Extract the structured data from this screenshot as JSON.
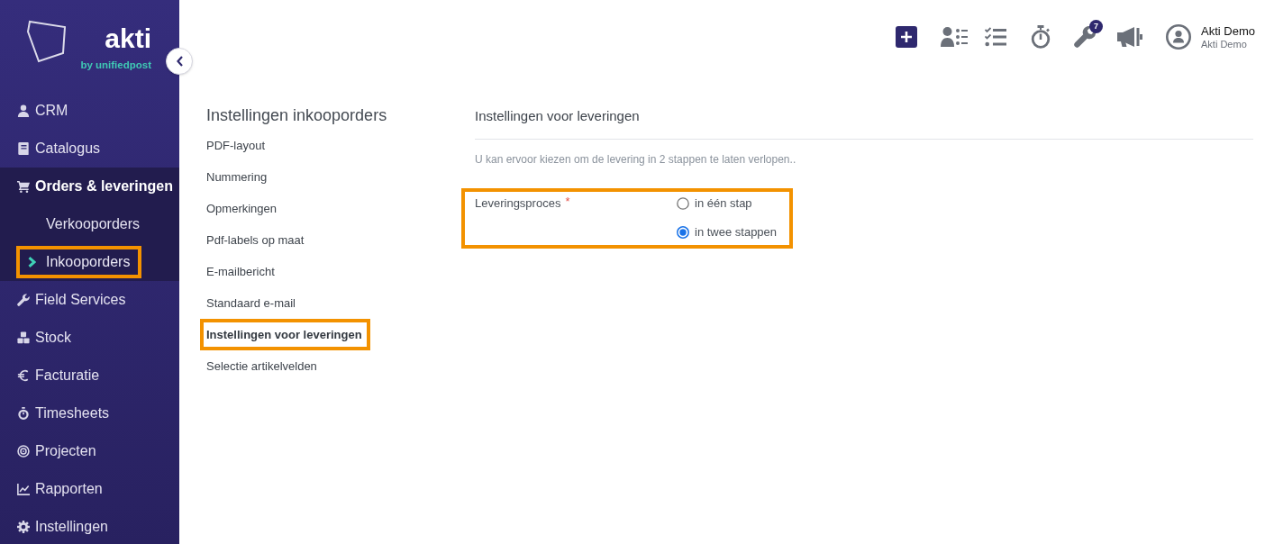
{
  "logo": {
    "wordmark": "akti",
    "tagline": "by unifiedpost"
  },
  "sidebar": {
    "items": [
      {
        "label": "CRM",
        "expanded": false
      },
      {
        "label": "Catalogus",
        "expanded": false
      },
      {
        "label": "Orders & leveringen",
        "expanded": true,
        "children": [
          {
            "label": "Verkooporders",
            "selected": false,
            "highlighted": false
          },
          {
            "label": "Inkooporders",
            "selected": true,
            "highlighted": true
          }
        ]
      },
      {
        "label": "Field Services",
        "expanded": false
      },
      {
        "label": "Stock",
        "expanded": false
      },
      {
        "label": "Facturatie",
        "expanded": false
      },
      {
        "label": "Timesheets",
        "expanded": false
      },
      {
        "label": "Projecten",
        "expanded": false
      },
      {
        "label": "Rapporten",
        "expanded": false
      },
      {
        "label": "Instellingen",
        "expanded": false
      }
    ]
  },
  "header": {
    "notification_count": "7",
    "user": {
      "name": "Akti Demo",
      "account": "Akti Demo"
    }
  },
  "settings_menu": {
    "title": "Instellingen inkooporders",
    "items": [
      {
        "label": "PDF-layout",
        "selected": false,
        "highlighted": false
      },
      {
        "label": "Nummering",
        "selected": false,
        "highlighted": false
      },
      {
        "label": "Opmerkingen",
        "selected": false,
        "highlighted": false
      },
      {
        "label": "Pdf-labels op maat",
        "selected": false,
        "highlighted": false
      },
      {
        "label": "E-mailbericht",
        "selected": false,
        "highlighted": false
      },
      {
        "label": "Standaard e-mail",
        "selected": false,
        "highlighted": false
      },
      {
        "label": "Instellingen voor leveringen",
        "selected": true,
        "highlighted": true
      },
      {
        "label": "Selectie artikelvelden",
        "selected": false,
        "highlighted": false
      }
    ]
  },
  "panel": {
    "title": "Instellingen voor leveringen",
    "description": "U kan ervoor kiezen om de levering in 2 stappen te laten verlopen..",
    "field": {
      "label": "Leveringsproces",
      "required_mark": "*",
      "highlighted": true,
      "options": [
        {
          "label": "in één stap",
          "selected": false
        },
        {
          "label": "in twee stappen",
          "selected": true
        }
      ]
    }
  }
}
